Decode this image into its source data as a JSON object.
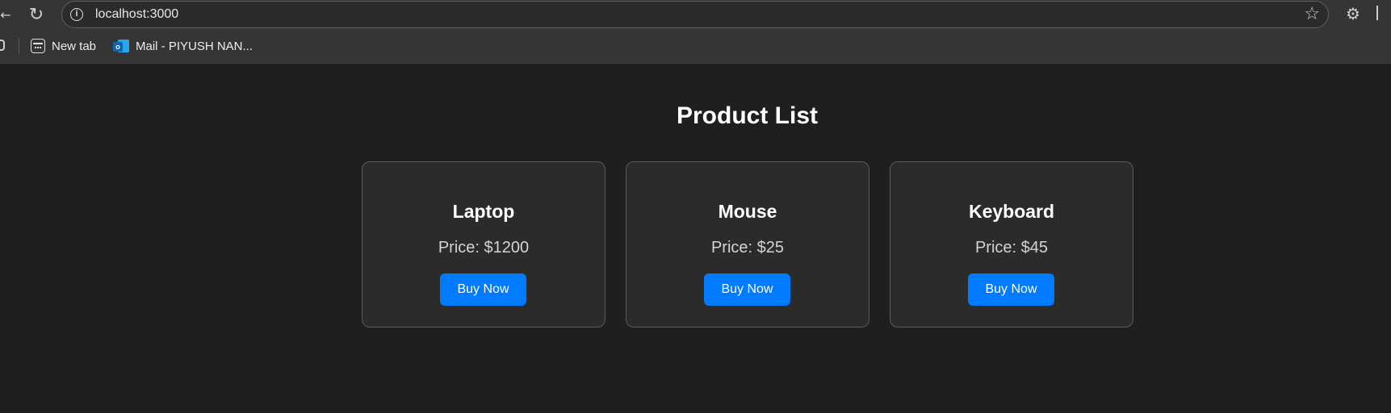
{
  "browser": {
    "url": "localhost:3000",
    "info_icon_glyph": "i",
    "bookmarks": [
      {
        "label": "New tab",
        "icon": "new-tab-icon"
      },
      {
        "label": "Mail - PIYUSH NAN...",
        "icon": "outlook-icon",
        "icon_letter": "o"
      }
    ]
  },
  "page": {
    "title": "Product List",
    "products": [
      {
        "name": "Laptop",
        "price": "Price: $1200",
        "button": "Buy Now"
      },
      {
        "name": "Mouse",
        "price": "Price: $25",
        "button": "Buy Now"
      },
      {
        "name": "Keyboard",
        "price": "Price: $45",
        "button": "Buy Now"
      }
    ]
  },
  "colors": {
    "background": "#1f1f1f",
    "card": "#2b2b2b",
    "card_border": "#5a5a5a",
    "button": "#007bff",
    "toolbar": "#353535"
  }
}
